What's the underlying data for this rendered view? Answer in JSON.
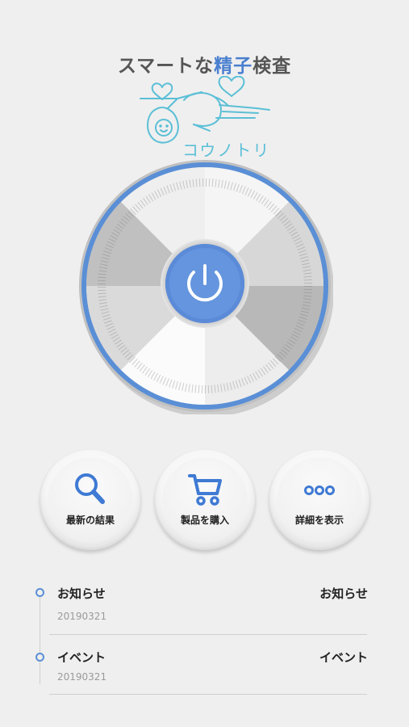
{
  "header": {
    "title_prefix": "スマートな",
    "title_accent": "精子",
    "title_suffix": "検査",
    "logo_text": "コウノトリ"
  },
  "power_button": {
    "icon": "power-icon"
  },
  "actions": [
    {
      "label": "最新の結果",
      "icon": "search-icon"
    },
    {
      "label": "製品を購入",
      "icon": "cart-icon"
    },
    {
      "label": "詳細を表示",
      "icon": "more-icon"
    }
  ],
  "news": [
    {
      "title": "お知らせ",
      "right": "お知らせ",
      "date": "20190321"
    },
    {
      "title": "イベント",
      "right": "イベント",
      "date": "20190321"
    }
  ],
  "colors": {
    "accent": "#4a7fcf",
    "ring": "#5a8fd6",
    "logo": "#5bbfd6"
  }
}
